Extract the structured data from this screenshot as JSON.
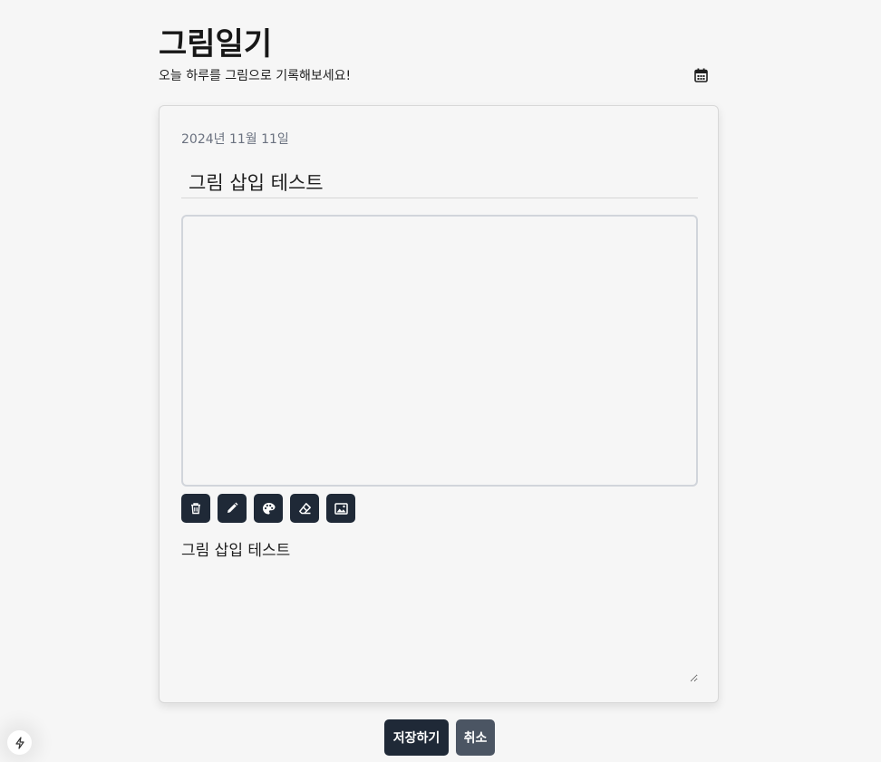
{
  "header": {
    "title": "그림일기",
    "subtitle": "오늘 하루를 그림으로 기록해보세요!"
  },
  "entry": {
    "date": "2024년 11월 11일",
    "title_value": "그림 삽입 테스트",
    "content_value": "그림 삽입 테스트"
  },
  "toolbar": {
    "tools": [
      {
        "name": "trash-icon"
      },
      {
        "name": "pencil-icon"
      },
      {
        "name": "palette-icon"
      },
      {
        "name": "eraser-icon"
      },
      {
        "name": "image-icon"
      }
    ]
  },
  "actions": {
    "save_label": "저장하기",
    "cancel_label": "취소"
  },
  "colors": {
    "background": "#f6f6f6",
    "button_dark": "#1f2937",
    "button_gray": "#4b5563"
  }
}
